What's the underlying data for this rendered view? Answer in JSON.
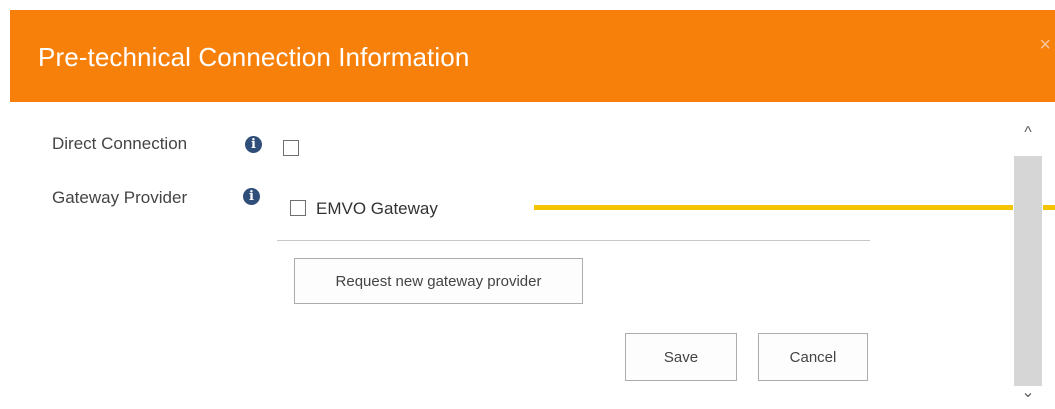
{
  "dialog": {
    "title": "Pre-technical Connection Information",
    "close_glyph": "×",
    "header_color": "#f7800a"
  },
  "form": {
    "direct_connection": {
      "label": "Direct Connection",
      "info_icon": "info-icon",
      "checked": false
    },
    "gateway_provider": {
      "label": "Gateway Provider",
      "info_icon": "info-icon",
      "options": [
        {
          "label": "EMVO Gateway",
          "checked": false
        }
      ]
    },
    "request_button_label": "Request new gateway provider"
  },
  "actions": {
    "save_label": "Save",
    "cancel_label": "Cancel"
  },
  "scrollbar": {
    "up_glyph": "^",
    "down_glyph": "⌄"
  },
  "annotation": {
    "color": "#f5c400"
  }
}
